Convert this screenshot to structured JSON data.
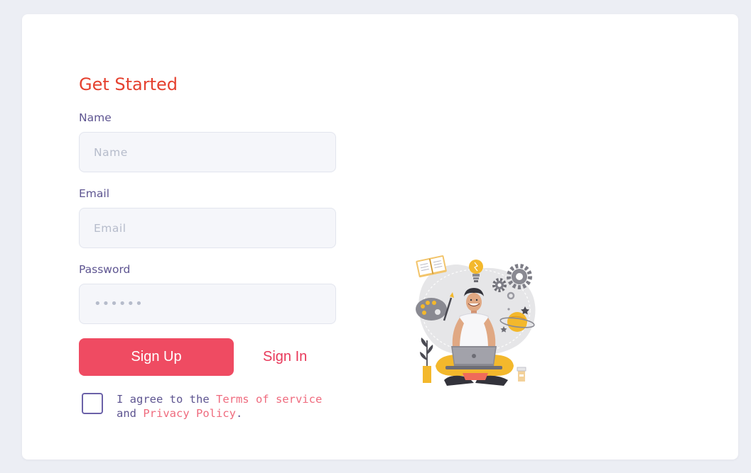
{
  "form": {
    "title": "Get Started",
    "name_label": "Name",
    "name_placeholder": "Name",
    "email_label": "Email",
    "email_placeholder": "Email",
    "password_label": "Password",
    "password_placeholder": "••••••",
    "signup_label": "Sign Up",
    "signin_label": "Sign In",
    "agree_prefix": "I agree to the ",
    "terms_link": "Terms of service",
    "agree_middle": " and ",
    "privacy_link": "Privacy Policy",
    "agree_suffix": ".",
    "agree_checked": false
  },
  "colors": {
    "accent": "#ef4b62",
    "title": "#e5412f",
    "label": "#5e5591",
    "input_bg": "#f5f6fa",
    "page_bg": "#eceef4"
  },
  "illustration": {
    "icon": "person-with-laptop-creative-icon"
  }
}
